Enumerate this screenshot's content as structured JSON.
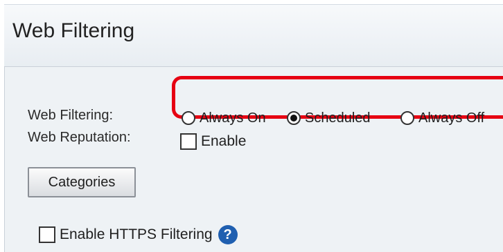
{
  "page": {
    "title": "Web Filtering"
  },
  "web_filtering": {
    "label": "Web Filtering:",
    "options": [
      {
        "label": "Always On",
        "selected": false
      },
      {
        "label": "Scheduled",
        "selected": true
      },
      {
        "label": "Always Off",
        "selected": false
      }
    ]
  },
  "web_reputation": {
    "label": "Web Reputation:",
    "checkbox_label": "Enable",
    "checked": false
  },
  "categories_button": {
    "label": "Categories"
  },
  "https_filtering": {
    "checkbox_label": "Enable HTTPS Filtering",
    "checked": false,
    "help_icon": "help-icon",
    "help_glyph": "?"
  },
  "colors": {
    "highlight_border": "#e60012",
    "help_icon_bg": "#1f5fb0",
    "panel_bg": "#eef2f5"
  }
}
